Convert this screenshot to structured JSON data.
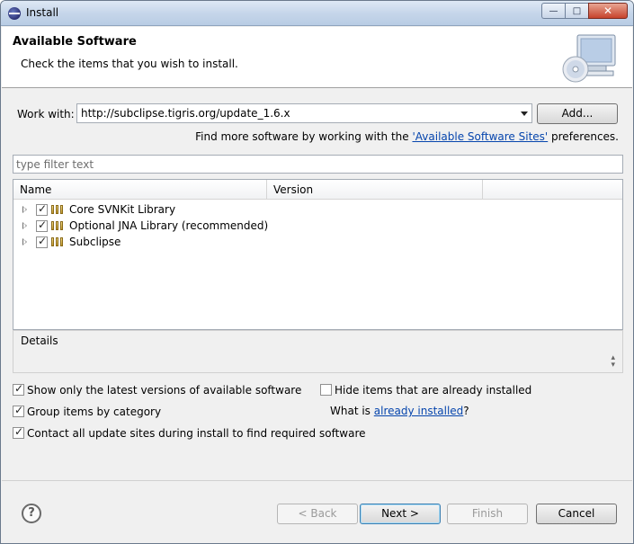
{
  "window": {
    "title": "Install"
  },
  "banner": {
    "title": "Available Software",
    "description": "Check the items that you wish to install."
  },
  "work_with": {
    "label": "Work with:",
    "value": "http://subclipse.tigris.org/update_1.6.x",
    "add_label": "Add...",
    "find_more_prefix": "Find more software by working with the ",
    "find_more_link": "'Available Software Sites'",
    "find_more_suffix": " preferences."
  },
  "filter": {
    "placeholder": "type filter text"
  },
  "tree": {
    "columns": [
      "Name",
      "Version"
    ],
    "items": [
      {
        "label": "Core SVNKit Library",
        "checked": true
      },
      {
        "label": "Optional JNA Library (recommended)",
        "checked": true
      },
      {
        "label": "Subclipse",
        "checked": true
      }
    ]
  },
  "details": {
    "label": "Details"
  },
  "options": {
    "show_latest": {
      "label": "Show only the latest versions of available software",
      "checked": true
    },
    "hide_installed": {
      "label": "Hide items that are already installed",
      "checked": false
    },
    "group_by_category": {
      "label": "Group items by category",
      "checked": true
    },
    "what_is_prefix": "What is ",
    "what_is_link": "already installed",
    "what_is_suffix": "?",
    "contact_sites": {
      "label": "Contact all update sites during install to find required software",
      "checked": true
    }
  },
  "buttons": {
    "back": "< Back",
    "next": "Next >",
    "finish": "Finish",
    "cancel": "Cancel",
    "help": "?"
  }
}
